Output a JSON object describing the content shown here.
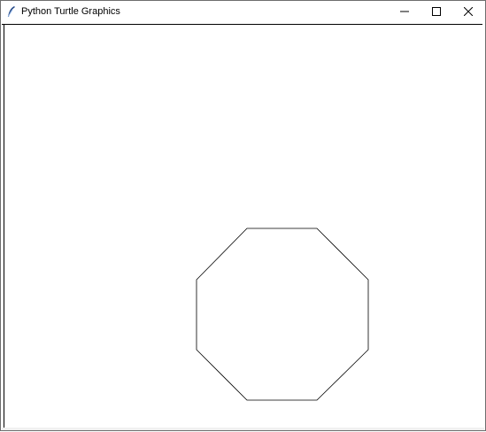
{
  "window": {
    "title": "Python Turtle Graphics",
    "app_icon": "feather-icon"
  },
  "controls": {
    "minimize_icon": "minimize-icon",
    "maximize_icon": "maximize-icon",
    "close_icon": "close-icon"
  },
  "canvas": {
    "background": "#ffffff",
    "shape": "octagon",
    "stroke_color": "#000000"
  }
}
